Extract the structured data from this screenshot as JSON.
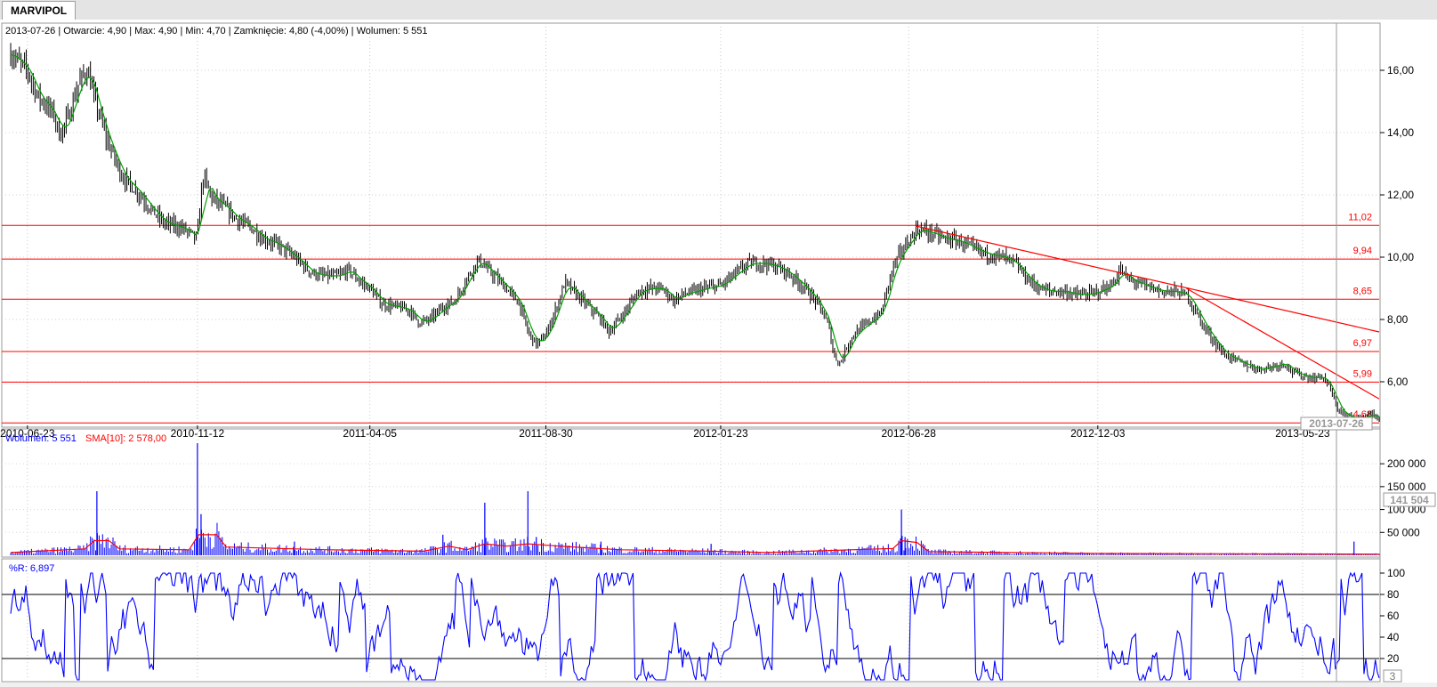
{
  "tab": {
    "label": "MARVIPOL"
  },
  "price_panel": {
    "info": "2013-07-26 | Otwarcie: 4,90 | Max: 4,90 | Min: 4,70 | Zamknięcie: 4,80 (-4,00%)  | Wolumen: 5 551",
    "current_date_label": "2013-07-26"
  },
  "volume_panel": {
    "label_volume": "Wolumen: 5 551",
    "label_sma": "SMA[10]: 2 578,00",
    "cursor_value": "141 504"
  },
  "wr_panel": {
    "label": "%R: 6,897",
    "cursor_value": "3"
  },
  "colors": {
    "price": "#000000",
    "sma": "#00a000",
    "support": "#ff0000",
    "volume": "#0000ff",
    "volume_sma": "#ff0000",
    "wr": "#0000ff"
  },
  "chart_data": [
    {
      "type": "ohlc",
      "title": "MARVIPOL",
      "x_range": [
        "2010-06-09",
        "2013-07-26"
      ],
      "ylim": [
        4.6,
        17.0
      ],
      "y_ticks": [
        "6,00",
        "8,00",
        "10,00",
        "12,00",
        "14,00",
        "16,00"
      ],
      "x_ticks": [
        "2010-06-23",
        "2010-11-12",
        "2011-04-05",
        "2011-08-30",
        "2012-01-23",
        "2012-06-28",
        "2012-12-03",
        "2013-05-23"
      ],
      "grid": true,
      "close_path": [
        [
          "2010-06-10",
          16.5
        ],
        [
          "2010-06-23",
          16.0
        ],
        [
          "2010-07-01",
          15.2
        ],
        [
          "2010-07-15",
          14.6
        ],
        [
          "2010-07-20",
          13.9
        ],
        [
          "2010-07-27",
          14.5
        ],
        [
          "2010-08-05",
          15.6
        ],
        [
          "2010-08-12",
          16.0
        ],
        [
          "2010-08-18",
          15.1
        ],
        [
          "2010-08-28",
          13.8
        ],
        [
          "2010-09-10",
          12.6
        ],
        [
          "2010-09-25",
          12.0
        ],
        [
          "2010-10-05",
          11.5
        ],
        [
          "2010-10-15",
          11.1
        ],
        [
          "2010-10-25",
          11.0
        ],
        [
          "2010-11-01",
          10.9
        ],
        [
          "2010-11-08",
          10.7
        ],
        [
          "2010-11-10",
          10.6
        ],
        [
          "2010-11-12",
          10.7
        ],
        [
          "2010-11-15",
          12.0
        ],
        [
          "2010-11-17",
          12.6
        ],
        [
          "2010-11-24",
          11.9
        ],
        [
          "2010-12-05",
          11.6
        ],
        [
          "2010-12-15",
          11.2
        ],
        [
          "2010-12-25",
          11.0
        ],
        [
          "2011-01-05",
          10.6
        ],
        [
          "2011-01-18",
          10.4
        ],
        [
          "2011-02-01",
          10.0
        ],
        [
          "2011-02-15",
          9.5
        ],
        [
          "2011-02-25",
          9.4
        ],
        [
          "2011-03-10",
          9.4
        ],
        [
          "2011-03-18",
          9.6
        ],
        [
          "2011-03-28",
          9.2
        ],
        [
          "2011-04-05",
          9.0
        ],
        [
          "2011-04-15",
          8.5
        ],
        [
          "2011-04-28",
          8.4
        ],
        [
          "2011-05-08",
          8.3
        ],
        [
          "2011-05-16",
          7.9
        ],
        [
          "2011-05-25",
          8.0
        ],
        [
          "2011-06-05",
          8.4
        ],
        [
          "2011-06-15",
          8.6
        ],
        [
          "2011-06-25",
          9.3
        ],
        [
          "2011-07-01",
          9.7
        ],
        [
          "2011-07-05",
          9.9
        ],
        [
          "2011-07-15",
          9.5
        ],
        [
          "2011-07-28",
          9.0
        ],
        [
          "2011-08-08",
          8.5
        ],
        [
          "2011-08-15",
          7.6
        ],
        [
          "2011-08-22",
          7.2
        ],
        [
          "2011-08-30",
          7.5
        ],
        [
          "2011-09-08",
          8.4
        ],
        [
          "2011-09-15",
          9.2
        ],
        [
          "2011-09-22",
          8.9
        ],
        [
          "2011-10-05",
          8.4
        ],
        [
          "2011-10-15",
          8.0
        ],
        [
          "2011-10-22",
          7.6
        ],
        [
          "2011-11-05",
          8.3
        ],
        [
          "2011-11-15",
          8.9
        ],
        [
          "2011-11-25",
          9.0
        ],
        [
          "2011-12-05",
          9.0
        ],
        [
          "2011-12-15",
          8.6
        ],
        [
          "2011-12-22",
          8.8
        ],
        [
          "2012-01-10",
          9.0
        ],
        [
          "2012-01-23",
          9.1
        ],
        [
          "2012-02-05",
          9.5
        ],
        [
          "2012-02-15",
          9.8
        ],
        [
          "2012-03-01",
          9.8
        ],
        [
          "2012-03-15",
          9.6
        ],
        [
          "2012-03-25",
          9.3
        ],
        [
          "2012-04-05",
          8.9
        ],
        [
          "2012-04-15",
          8.4
        ],
        [
          "2012-04-22",
          7.8
        ],
        [
          "2012-04-27",
          6.8
        ],
        [
          "2012-05-02",
          6.6
        ],
        [
          "2012-05-08",
          7.2
        ],
        [
          "2012-05-15",
          7.6
        ],
        [
          "2012-05-25",
          7.9
        ],
        [
          "2012-06-05",
          8.2
        ],
        [
          "2012-06-10",
          9.0
        ],
        [
          "2012-06-15",
          9.7
        ],
        [
          "2012-06-22",
          10.2
        ],
        [
          "2012-06-28",
          10.5
        ],
        [
          "2012-07-05",
          10.9
        ],
        [
          "2012-07-15",
          10.8
        ],
        [
          "2012-07-28",
          10.6
        ],
        [
          "2012-08-10",
          10.5
        ],
        [
          "2012-08-20",
          10.3
        ],
        [
          "2012-09-01",
          10.1
        ],
        [
          "2012-09-15",
          10.0
        ],
        [
          "2012-09-25",
          9.8
        ],
        [
          "2012-10-05",
          9.3
        ],
        [
          "2012-10-15",
          9.0
        ],
        [
          "2012-10-25",
          8.9
        ],
        [
          "2012-11-05",
          8.9
        ],
        [
          "2012-11-15",
          8.8
        ],
        [
          "2012-11-25",
          8.8
        ],
        [
          "2012-12-03",
          8.9
        ],
        [
          "2012-12-15",
          9.1
        ],
        [
          "2012-12-22",
          9.6
        ],
        [
          "2012-12-28",
          9.3
        ],
        [
          "2013-01-10",
          9.1
        ],
        [
          "2013-01-25",
          8.9
        ],
        [
          "2013-02-05",
          8.9
        ],
        [
          "2013-02-15",
          8.8
        ],
        [
          "2013-02-22",
          8.3
        ],
        [
          "2013-03-01",
          7.8
        ],
        [
          "2013-03-10",
          7.3
        ],
        [
          "2013-03-18",
          6.9
        ],
        [
          "2013-03-28",
          6.7
        ],
        [
          "2013-04-08",
          6.5
        ],
        [
          "2013-04-18",
          6.4
        ],
        [
          "2013-04-28",
          6.5
        ],
        [
          "2013-05-08",
          6.6
        ],
        [
          "2013-05-15",
          6.3
        ],
        [
          "2013-05-23",
          6.2
        ],
        [
          "2013-06-01",
          6.1
        ],
        [
          "2013-06-08",
          6.2
        ],
        [
          "2013-06-15",
          5.8
        ],
        [
          "2013-06-20",
          5.2
        ],
        [
          "2013-06-28",
          4.9
        ],
        [
          "2013-07-05",
          4.85
        ],
        [
          "2013-07-12",
          4.8
        ],
        [
          "2013-07-18",
          5.0
        ],
        [
          "2013-07-26",
          4.8
        ]
      ],
      "support_lines": [
        {
          "value": 11.02,
          "label": "11,02"
        },
        {
          "value": 9.94,
          "label": "9,94"
        },
        {
          "value": 8.65,
          "label": "8,65"
        },
        {
          "value": 6.97,
          "label": "6,97"
        },
        {
          "value": 5.99,
          "label": "5,99"
        },
        {
          "value": 4.68,
          "label": "4,68"
        }
      ],
      "trend_lines": [
        {
          "from": [
            "2012-07-04",
            11.0
          ],
          "to": [
            "2013-07-26",
            7.6
          ]
        },
        {
          "from": [
            "2013-02-15",
            9.0
          ],
          "to": [
            "2013-07-26",
            5.45
          ]
        }
      ],
      "series": [
        {
          "name": "SMA"
        }
      ]
    },
    {
      "type": "bar",
      "ylim": [
        0,
        245000
      ],
      "y_ticks": [
        "50 000",
        "100 000",
        "150 000",
        "200 000"
      ],
      "spikes": [
        [
          "2010-08-20",
          140000
        ],
        [
          "2010-11-12",
          245000
        ],
        [
          "2010-11-15",
          90000
        ],
        [
          "2011-02-01",
          30000
        ],
        [
          "2011-06-05",
          45000
        ],
        [
          "2011-07-10",
          115000
        ],
        [
          "2011-08-15",
          140000
        ],
        [
          "2011-08-22",
          40000
        ],
        [
          "2011-10-15",
          30000
        ],
        [
          "2012-01-15",
          25000
        ],
        [
          "2012-06-22",
          100000
        ],
        [
          "2012-06-25",
          40000
        ],
        [
          "2013-07-05",
          30000
        ]
      ],
      "sma_path": [
        [
          "2010-06-09",
          6000
        ],
        [
          "2010-08-10",
          14000
        ],
        [
          "2010-08-18",
          32000
        ],
        [
          "2010-08-30",
          32000
        ],
        [
          "2010-09-08",
          14000
        ],
        [
          "2010-11-05",
          12000
        ],
        [
          "2010-11-13",
          45000
        ],
        [
          "2010-11-28",
          45000
        ],
        [
          "2010-12-06",
          18000
        ],
        [
          "2011-03-01",
          12000
        ],
        [
          "2011-05-20",
          9000
        ],
        [
          "2011-06-10",
          20000
        ],
        [
          "2011-06-25",
          12000
        ],
        [
          "2011-07-10",
          25000
        ],
        [
          "2011-07-28",
          20000
        ],
        [
          "2011-08-15",
          25000
        ],
        [
          "2011-09-10",
          20000
        ],
        [
          "2011-11-01",
          12000
        ],
        [
          "2012-01-15",
          9000
        ],
        [
          "2012-03-01",
          6000
        ],
        [
          "2012-06-15",
          15000
        ],
        [
          "2012-06-22",
          32000
        ],
        [
          "2012-07-05",
          28000
        ],
        [
          "2012-07-15",
          8000
        ],
        [
          "2012-12-01",
          4000
        ],
        [
          "2013-07-26",
          2600
        ]
      ],
      "series": []
    },
    {
      "type": "line",
      "ylim": [
        0,
        100
      ],
      "y_ticks": [
        "20",
        "40",
        "60",
        "80",
        "100"
      ],
      "ref_lines": [
        20,
        80
      ],
      "series": []
    }
  ]
}
